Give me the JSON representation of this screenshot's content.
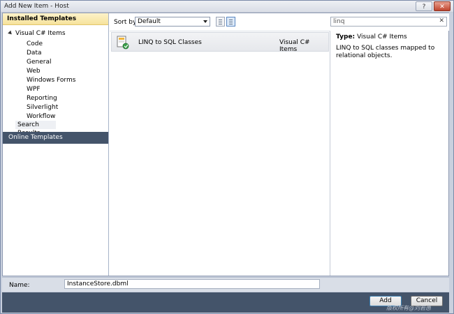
{
  "window": {
    "title": "Add New Item - Host",
    "help_label": "?",
    "close_label": "✕"
  },
  "left_pane": {
    "header": "Installed Templates",
    "root": "Visual C# Items",
    "items": [
      "Code",
      "Data",
      "General",
      "Web",
      "Windows Forms",
      "WPF",
      "Reporting",
      "Silverlight",
      "Workflow"
    ],
    "selected": "Search Results",
    "online": "Online Templates"
  },
  "toolbar": {
    "sort_label": "Sort by:",
    "sort_value": "Default",
    "search_value": "linq",
    "search_clear": "✕"
  },
  "list": {
    "items": [
      {
        "name": "LINQ to SQL Classes",
        "type": "Visual C# Items"
      }
    ]
  },
  "details": {
    "type_label": "Type:",
    "type_value": "Visual C# Items",
    "description": "LINQ to SQL classes mapped to relational objects."
  },
  "name_row": {
    "label": "Name:",
    "value": "InstanceStore.dbml"
  },
  "buttons": {
    "add": "Add",
    "cancel": "Cancel"
  },
  "watermark": "版权所有@刘若愚"
}
